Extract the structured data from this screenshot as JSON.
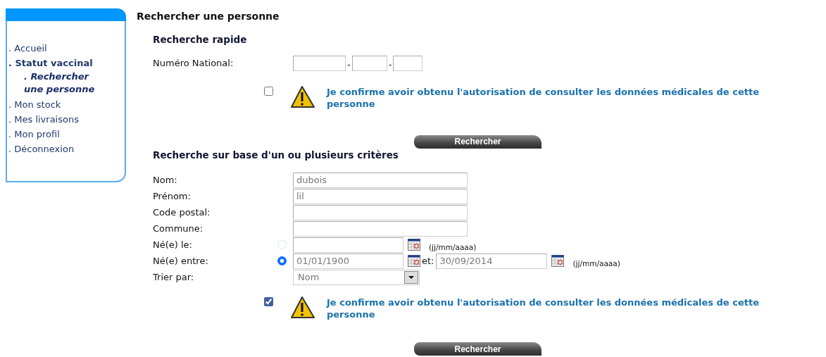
{
  "sidebar": {
    "items": [
      {
        "label": ". Accueil",
        "selected": false
      },
      {
        "label": ". Statut vaccinal",
        "selected": true,
        "children": [
          {
            "label": ". Rechercher une personne",
            "selected": true
          }
        ]
      },
      {
        "label": ". Mon stock",
        "selected": false
      },
      {
        "label": ". Mes livraisons",
        "selected": false
      },
      {
        "label": ". Mon profil",
        "selected": false
      },
      {
        "label": ". Déconnexion",
        "selected": false
      }
    ]
  },
  "page_title": "Rechercher une personne",
  "quick_search": {
    "title": "Recherche rapide",
    "label": "Numéro National:",
    "separators": [
      "-",
      "-"
    ],
    "confirm": {
      "checked": false,
      "text": "Je confirme avoir obtenu l'autorisation de consulter les données médicales de cette personne"
    },
    "button": "Rechercher"
  },
  "criteria_search": {
    "title": "Recherche sur base d'un ou plusieurs critères",
    "rows": [
      {
        "kind": "text",
        "label": "Nom:",
        "value": "dubois"
      },
      {
        "kind": "text",
        "label": "Prénom:",
        "value": "lil"
      },
      {
        "kind": "text",
        "label": "Code postal:"
      },
      {
        "kind": "text",
        "label": "Commune:"
      },
      {
        "kind": "date",
        "label": "Né(e) le:",
        "selected": false,
        "hint": "(jj/mm/aaaa)"
      },
      {
        "kind": "range",
        "label": "Né(e) entre:",
        "selected": true,
        "value": "01/01/1900",
        "to_label": "et:",
        "to_value": "30/09/2014",
        "hint": "(jj/mm/aaaa)"
      },
      {
        "kind": "select",
        "label": "Trier par:",
        "value": "Nom"
      }
    ],
    "confirm": {
      "checked": true,
      "text": "Je confirme avoir obtenu l'autorisation de consulter les données médicales de cette personne"
    },
    "button": "Rechercher"
  }
}
